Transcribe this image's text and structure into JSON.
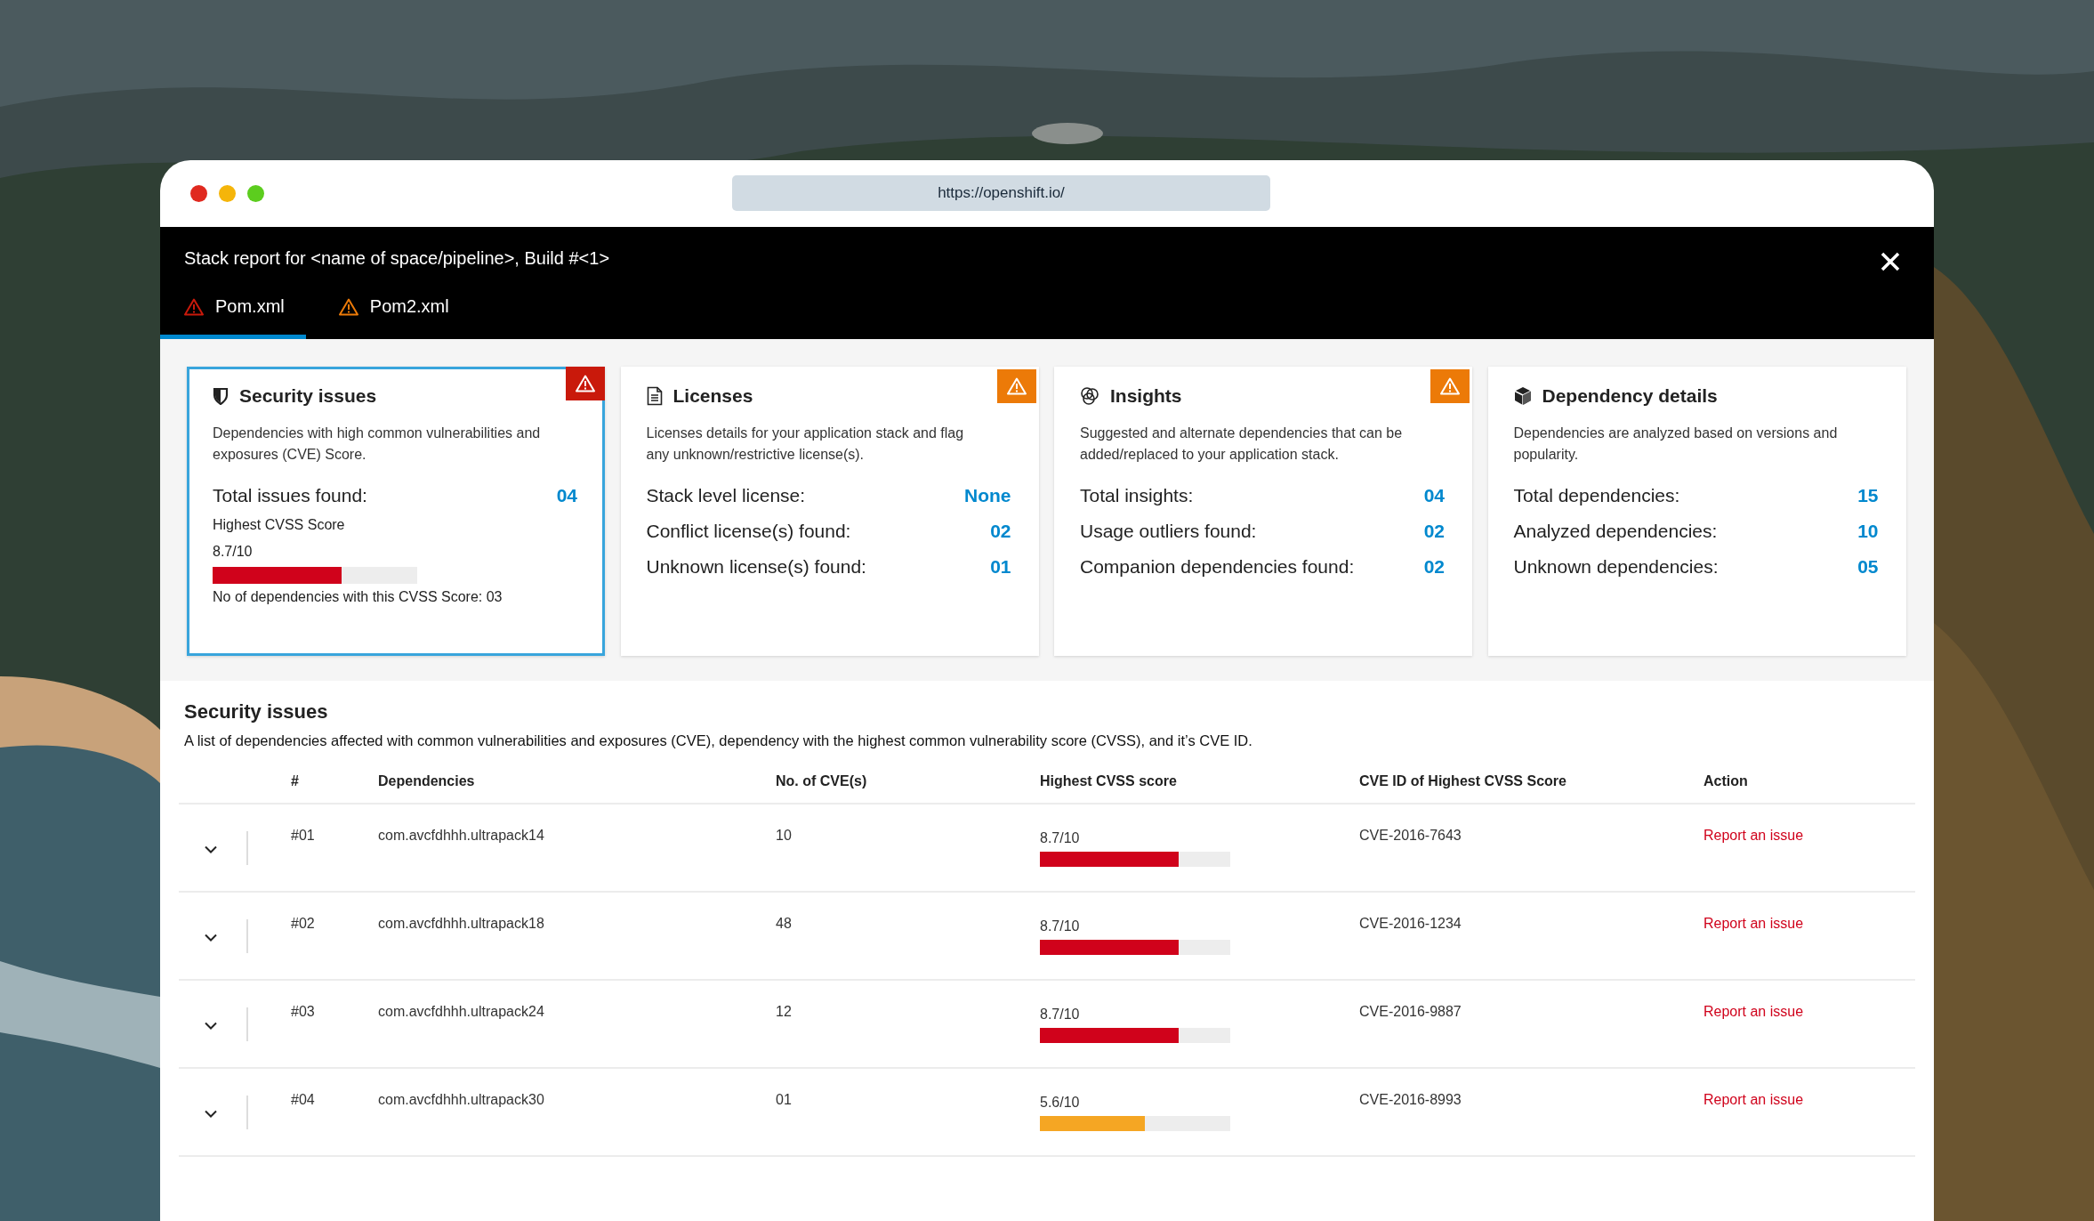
{
  "browser": {
    "url": "https://openshift.io/"
  },
  "header": {
    "title": "Stack report for <name of space/pipeline>, Build #<1>"
  },
  "tabs": [
    {
      "label": "Pom.xml",
      "selected": true,
      "color": "#c9190b"
    },
    {
      "label": "Pom2.xml",
      "selected": false,
      "color": "#ec7a08"
    }
  ],
  "cards": [
    {
      "kind": "security",
      "title": "Security issues",
      "selected": true,
      "color": "#c9190b",
      "description": "Dependencies with high common vulnerabilities and exposures (CVE) Score.",
      "stats": [
        {
          "label": "Total issues found:",
          "value": "04"
        }
      ],
      "cvss_label": "Highest CVSS Score",
      "cvss_score": "8.7/10",
      "level": 0.63,
      "note": "No of dependencies with this CVSS Score: 03"
    },
    {
      "kind": "licenses",
      "title": "Licenses",
      "selected": false,
      "color": "#ec7a08",
      "description": "Licenses details for your application stack and flag any unknown/restrictive license(s).",
      "stats": [
        {
          "label": "Stack level license:",
          "value": "None"
        },
        {
          "label": "Conflict license(s) found:",
          "value": "02"
        },
        {
          "label": "Unknown license(s) found:",
          "value": "01"
        }
      ]
    },
    {
      "kind": "insights",
      "title": "Insights",
      "selected": false,
      "color": "#ec7a08",
      "description": "Suggested and alternate dependencies that can be added/replaced to your application stack.",
      "stats": [
        {
          "label": "Total insights:",
          "value": "04"
        },
        {
          "label": "Usage outliers found:",
          "value": "02"
        },
        {
          "label": "Companion dependencies found:",
          "value": "02"
        }
      ]
    },
    {
      "kind": "dependencies",
      "title": "Dependency details",
      "selected": false,
      "description": "Dependencies are analyzed based on versions and popularity.",
      "stats": [
        {
          "label": "Total dependencies:",
          "value": "15"
        },
        {
          "label": "Analyzed dependencies:",
          "value": "10"
        },
        {
          "label": "Unknown dependencies:",
          "value": "05"
        }
      ]
    }
  ],
  "security_section": {
    "title": "Security issues",
    "description": "A list of dependencies affected with common vulnerabilities and exposures (CVE), dependency with the highest common vulnerability score (CVSS), and it’s CVE ID."
  },
  "table": {
    "columns": [
      "#",
      "Dependencies",
      "No. of CVE(s)",
      "Highest CVSS score",
      "CVE ID of Highest CVSS Score",
      "Action"
    ],
    "rows": [
      {
        "expanded": false,
        "number": "#01",
        "dependency": "com.avcfdhhh.ultrapack14",
        "cve_count": "10",
        "score": "8.7/10",
        "level": 0.73,
        "color": "#d0021b",
        "cve_id": "CVE-2016-7643",
        "action": "Report an issue"
      },
      {
        "expanded": false,
        "number": "#02",
        "dependency": "com.avcfdhhh.ultrapack18",
        "cve_count": "48",
        "score": "8.7/10",
        "level": 0.73,
        "color": "#d0021b",
        "cve_id": "CVE-2016-1234",
        "action": "Report an issue"
      },
      {
        "expanded": false,
        "number": "#03",
        "dependency": "com.avcfdhhh.ultrapack24",
        "cve_count": "12",
        "score": "8.7/10",
        "level": 0.73,
        "color": "#d0021b",
        "cve_id": "CVE-2016-9887",
        "action": "Report an issue"
      },
      {
        "expanded": false,
        "number": "#04",
        "dependency": "com.avcfdhhh.ultrapack30",
        "cve_count": "01",
        "score": "5.6/10",
        "level": 0.55,
        "color": "#f5a623",
        "cve_id": "CVE-2016-8993",
        "action": "Report an issue"
      }
    ]
  }
}
